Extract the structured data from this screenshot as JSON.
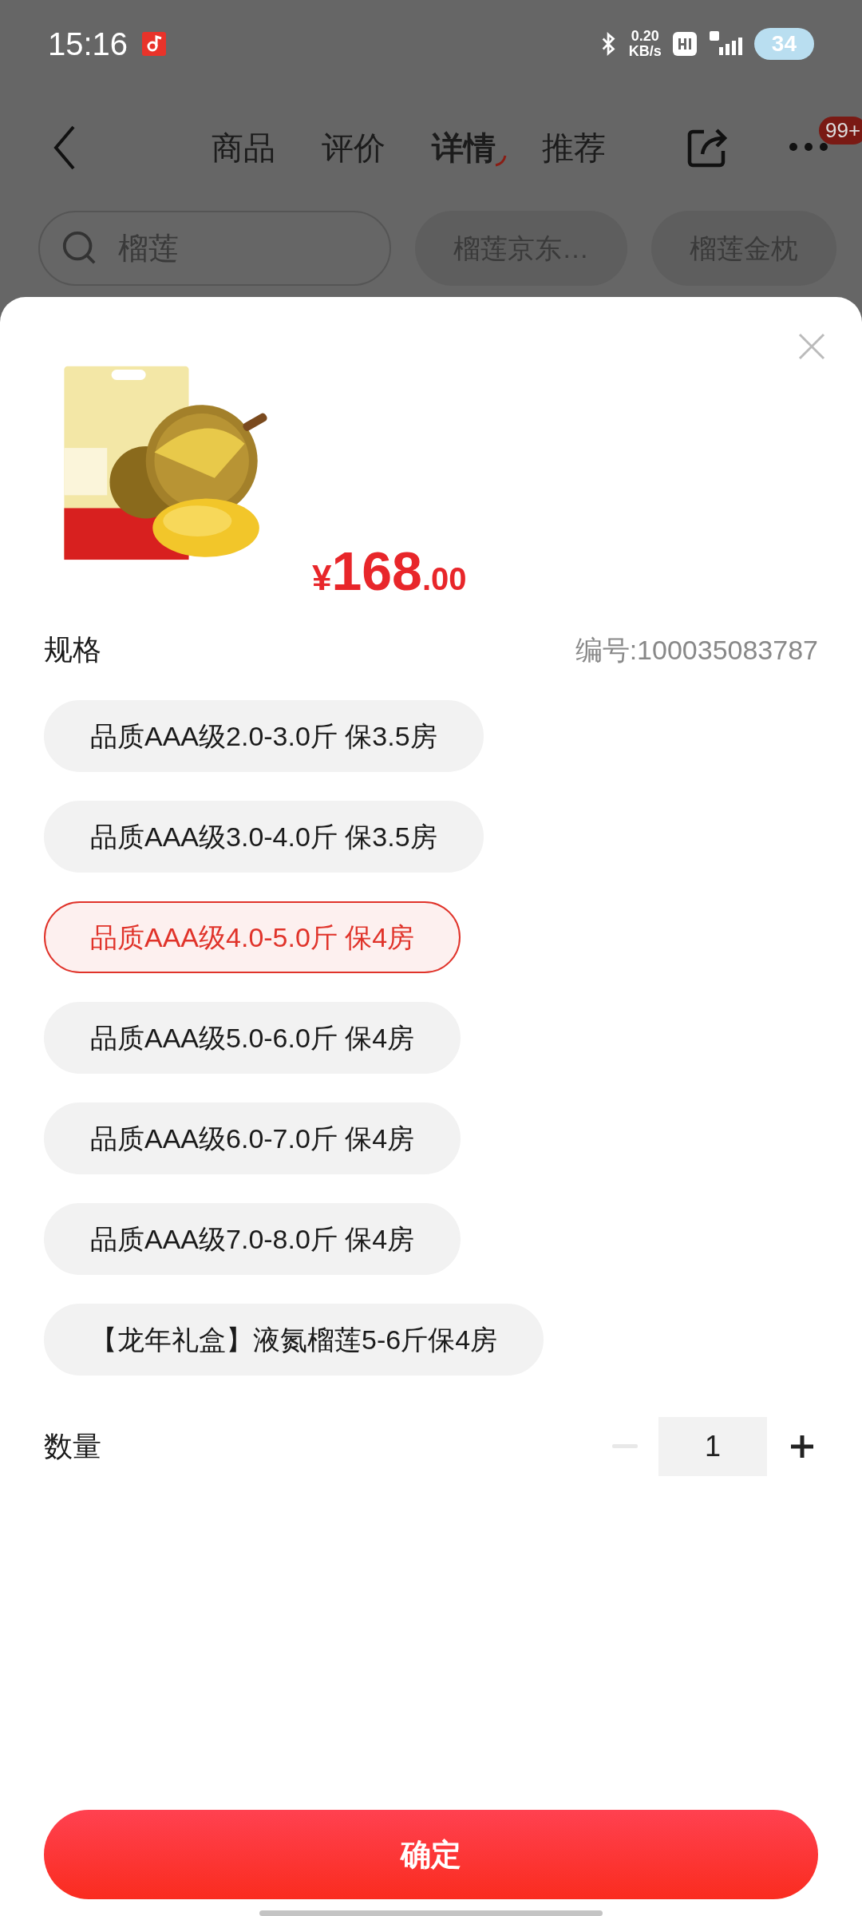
{
  "status_bar": {
    "time": "15:16",
    "net_speed": "0.20",
    "net_unit": "KB/s",
    "battery": "34"
  },
  "nav": {
    "tabs": [
      {
        "label": "商品",
        "selected": false
      },
      {
        "label": "评价",
        "selected": false
      },
      {
        "label": "详情",
        "selected": true
      },
      {
        "label": "推荐",
        "selected": false
      }
    ],
    "badge": "99+"
  },
  "search": {
    "placeholder": "榴莲",
    "suggestions": [
      "榴莲京东…",
      "榴莲金枕"
    ]
  },
  "sheet": {
    "price": {
      "currency": "¥",
      "integer": "168",
      "decimals": ".00"
    },
    "spec_label": "规格",
    "sku": "编号:100035083787",
    "options": [
      {
        "label": "品质AAA级2.0-3.0斤 保3.5房",
        "selected": false
      },
      {
        "label": "品质AAA级3.0-4.0斤 保3.5房",
        "selected": false
      },
      {
        "label": "品质AAA级4.0-5.0斤 保4房",
        "selected": true
      },
      {
        "label": "品质AAA级5.0-6.0斤 保4房",
        "selected": false
      },
      {
        "label": "品质AAA级6.0-7.0斤 保4房",
        "selected": false
      },
      {
        "label": "品质AAA级7.0-8.0斤 保4房",
        "selected": false
      },
      {
        "label": "【龙年礼盒】液氮榴莲5-6斤保4房",
        "selected": false
      }
    ],
    "quantity": {
      "label": "数量",
      "value": "1",
      "decrement_disabled": true
    },
    "confirm": "确定"
  }
}
